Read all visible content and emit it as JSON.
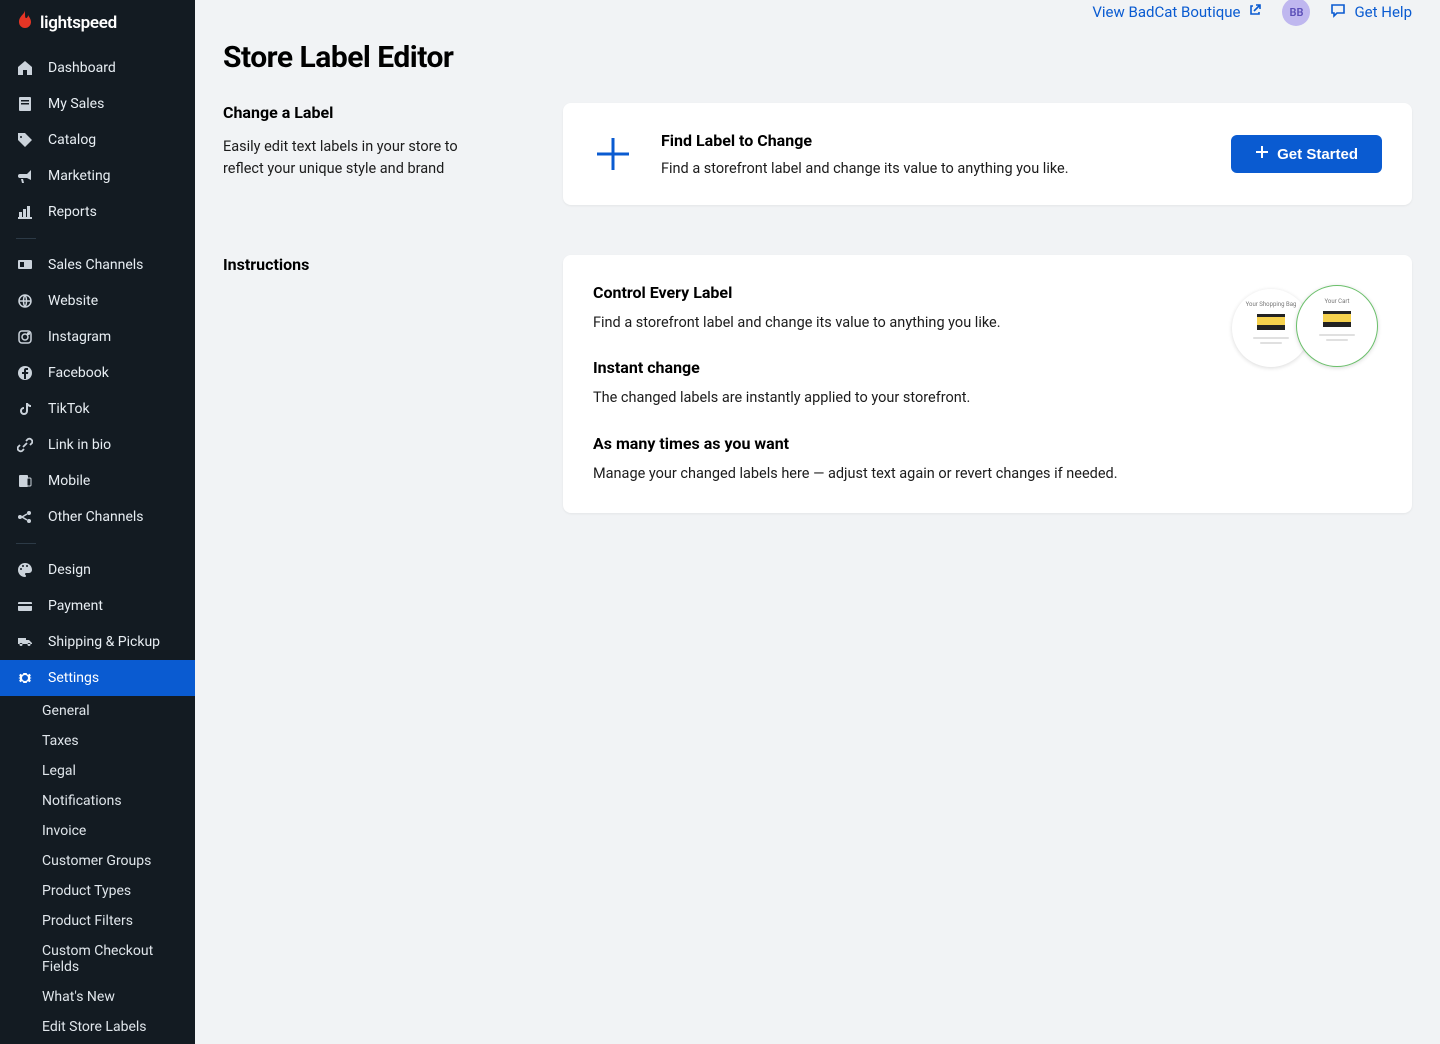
{
  "brand": {
    "name": "lightspeed"
  },
  "topbar": {
    "view_store": "View BadCat Boutique",
    "avatar_initials": "BB",
    "help": "Get Help"
  },
  "sidebar": {
    "items": [
      {
        "label": "Dashboard"
      },
      {
        "label": "My Sales"
      },
      {
        "label": "Catalog"
      },
      {
        "label": "Marketing"
      },
      {
        "label": "Reports"
      }
    ],
    "channels": [
      {
        "label": "Sales Channels"
      },
      {
        "label": "Website"
      },
      {
        "label": "Instagram"
      },
      {
        "label": "Facebook"
      },
      {
        "label": "TikTok"
      },
      {
        "label": "Link in bio"
      },
      {
        "label": "Mobile"
      },
      {
        "label": "Other Channels"
      }
    ],
    "store": [
      {
        "label": "Design"
      },
      {
        "label": "Payment"
      },
      {
        "label": "Shipping & Pickup"
      },
      {
        "label": "Settings"
      }
    ],
    "settings_sub": [
      "General",
      "Taxes",
      "Legal",
      "Notifications",
      "Invoice",
      "Customer Groups",
      "Product Types",
      "Product Filters",
      "Custom Checkout Fields",
      "What's New",
      "Edit Store Labels"
    ]
  },
  "page": {
    "title": "Store Label Editor"
  },
  "section_change": {
    "title": "Change a Label",
    "desc": "Easily edit text labels in your store to reflect your unique style and brand"
  },
  "find_card": {
    "title": "Find Label to Change",
    "desc": "Find a storefront label and change its value to anything you like.",
    "button": "Get Started"
  },
  "section_instructions": {
    "title": "Instructions",
    "blocks": [
      {
        "title": "Control Every Label",
        "desc": "Find a storefront label and change its value to anything you like."
      },
      {
        "title": "Instant change",
        "desc": "The changed labels are instantly applied to your storefront."
      },
      {
        "title": "As many times as you want",
        "desc": "Manage your changed labels here — adjust text again or revert changes if needed."
      }
    ]
  },
  "illustration": {
    "left_label": "Your Shopping Bag",
    "right_label": "Your Cart"
  }
}
